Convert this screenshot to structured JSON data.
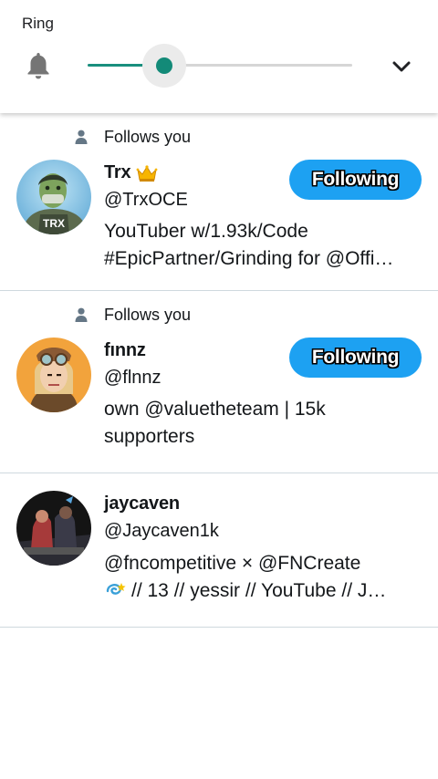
{
  "volume_panel": {
    "label": "Ring",
    "level": 0.29,
    "icons": {
      "stream": "bell-icon",
      "expand": "chevron-down-icon"
    },
    "accent_color": "#138a78"
  },
  "colors": {
    "follow_button": "#1da1f2",
    "divider": "#cfd9de"
  },
  "users": [
    {
      "follows_you": "Follows you",
      "name": "Trx",
      "name_emoji": "crown-icon",
      "handle": "@TrxOCE",
      "bio_lines": [
        "YouTuber w/1.93k/Code",
        "#EpicPartner/Grinding for @Offi…"
      ],
      "button": "Following"
    },
    {
      "follows_you": "Follows you",
      "name": "fınnz",
      "handle": "@flnnz",
      "bio_lines": [
        "own @valuetheteam | 15k",
        "supporters"
      ],
      "button": "Following"
    },
    {
      "name": "jaycaven",
      "handle": "@Jaycaven1k",
      "bio_lines": [
        "@fncompetitive × @FNCreate",
        "// 13 // yessir // YouTube // J…"
      ],
      "bio_emoji": "dizzy-icon"
    }
  ]
}
